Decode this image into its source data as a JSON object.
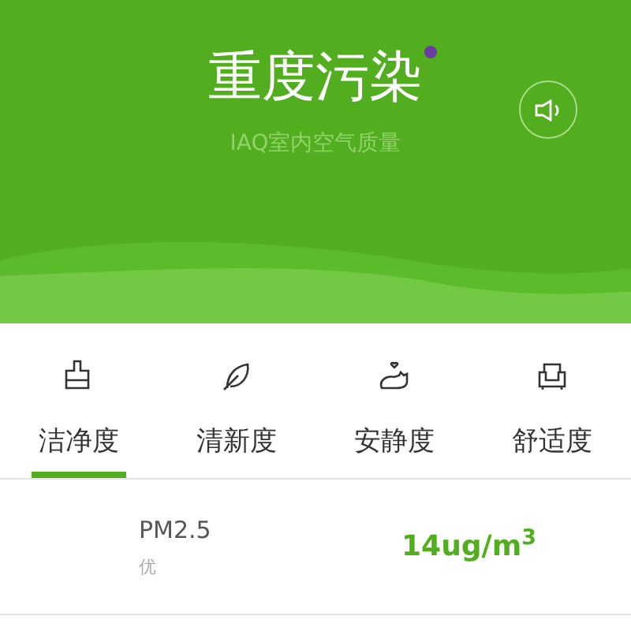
{
  "header": {
    "title": "重度污染",
    "subtitle": "IAQ室内空气质量"
  },
  "tabs": [
    {
      "label": "洁净度",
      "kind": "brush",
      "selected": true
    },
    {
      "label": "清新度",
      "kind": "leaf",
      "selected": false
    },
    {
      "label": "安静度",
      "kind": "cat",
      "selected": false
    },
    {
      "label": "舒适度",
      "kind": "sofa",
      "selected": false
    }
  ],
  "readings": [
    {
      "name": "PM2.5",
      "grade": "优",
      "value": "14ug/m$^{3}$"
    }
  ]
}
